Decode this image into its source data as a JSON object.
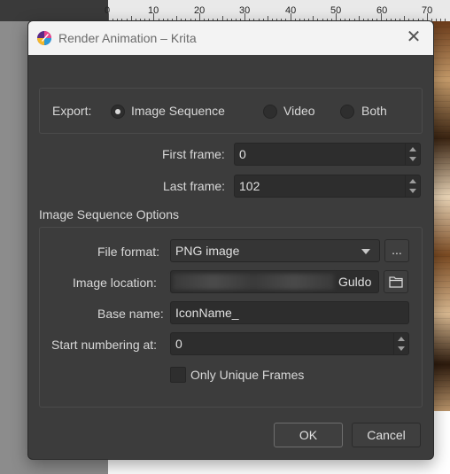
{
  "background": {
    "ruler_ticks": [
      "0",
      "10",
      "20",
      "30",
      "40",
      "50",
      "60",
      "70"
    ]
  },
  "dialog": {
    "title": "Render Animation – Krita",
    "app_icon": "krita-logo-icon",
    "close_icon": "close-icon",
    "export": {
      "label": "Export:",
      "options": [
        {
          "label": "Image Sequence",
          "selected": true
        },
        {
          "label": "Video",
          "selected": false
        },
        {
          "label": "Both",
          "selected": false
        }
      ]
    },
    "first_frame": {
      "label": "First frame:",
      "value": "0"
    },
    "last_frame": {
      "label": "Last frame:",
      "value": "102"
    },
    "image_sequence_options": {
      "heading": "Image Sequence Options",
      "file_format": {
        "label": "File format:",
        "value": "PNG image",
        "more_label": "..."
      },
      "image_location": {
        "label": "Image location:",
        "visible_suffix": "Guldo",
        "folder_icon": "folder-icon"
      },
      "base_name": {
        "label": "Base name:",
        "value": "IconName_"
      },
      "start_numbering": {
        "label": "Start numbering at:",
        "value": "0"
      },
      "only_unique_frames": {
        "label": "Only Unique Frames",
        "checked": false
      }
    },
    "buttons": {
      "ok": "OK",
      "cancel": "Cancel"
    }
  }
}
